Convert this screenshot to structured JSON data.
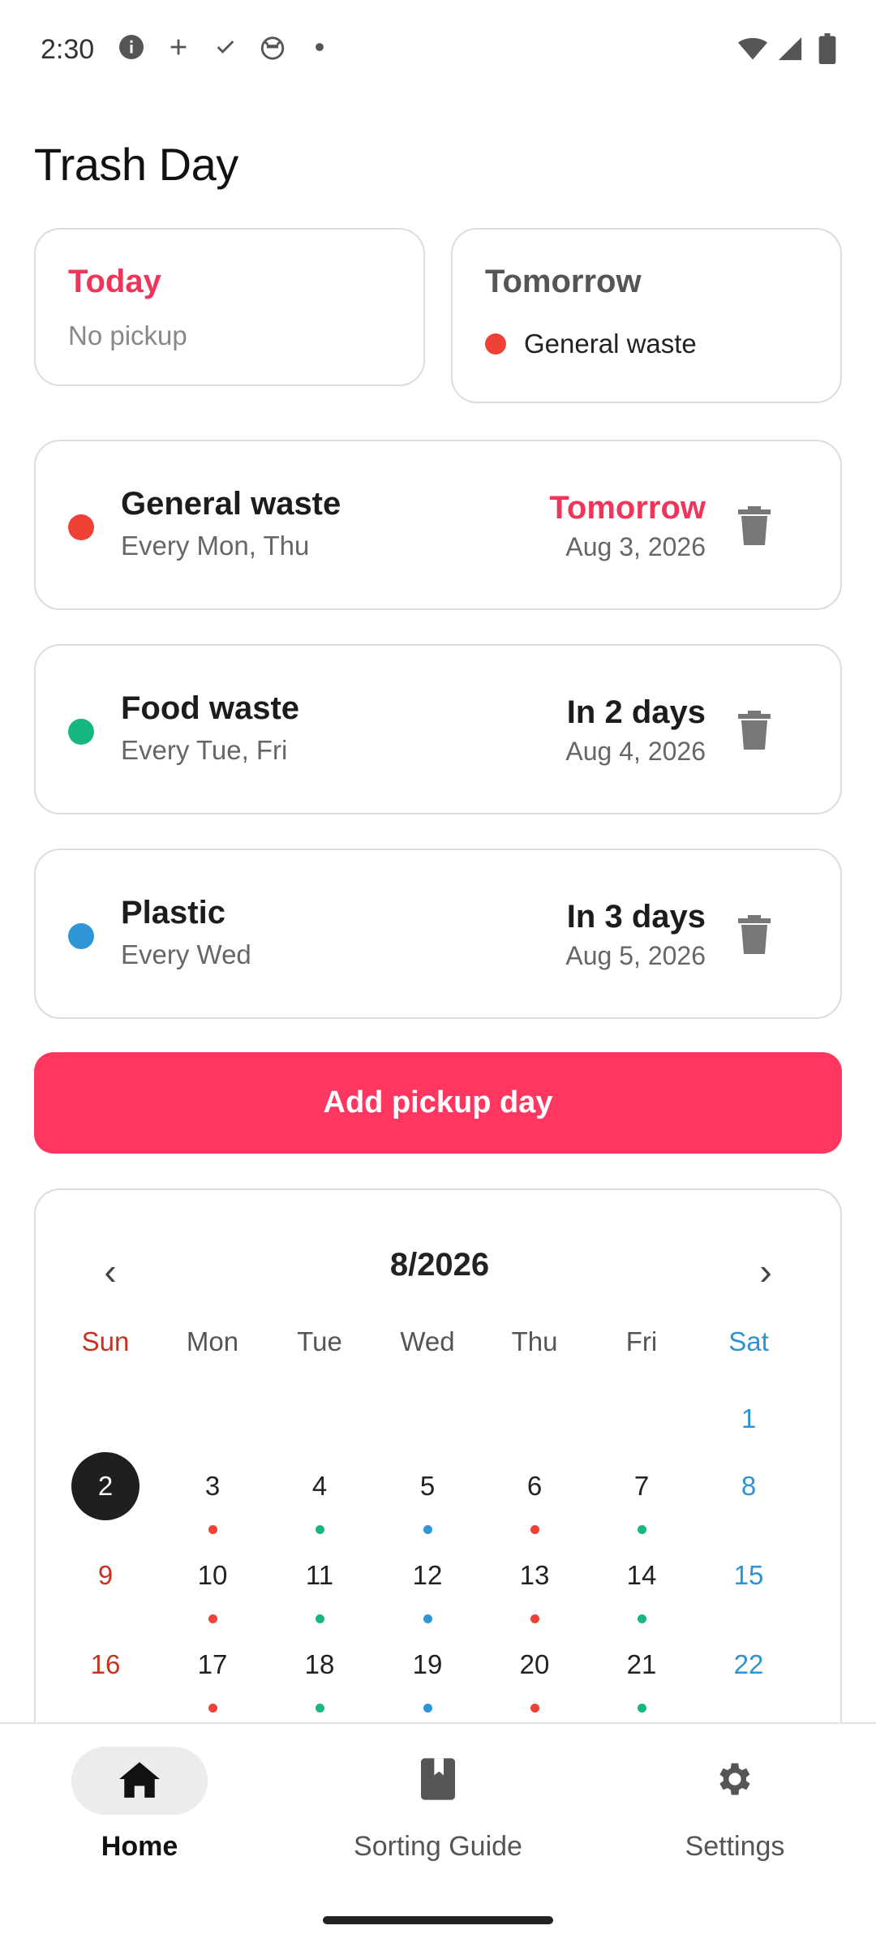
{
  "status_bar": {
    "time": "2:30",
    "left_icons": [
      "info-icon",
      "plus-icon",
      "check-icon",
      "cat-face-icon",
      "dot-icon"
    ],
    "right_icons": [
      "wifi-icon",
      "signal-icon",
      "battery-icon"
    ]
  },
  "header": {
    "title": "Trash Day"
  },
  "summary": {
    "today": {
      "label": "Today",
      "sub": "No pickup"
    },
    "tomorrow": {
      "label": "Tomorrow",
      "item": "General waste",
      "item_color": "#ef4136"
    }
  },
  "pickups": [
    {
      "name": "General waste",
      "schedule": "Every Mon, Thu",
      "when": "Tomorrow",
      "date": "Aug 3, 2026",
      "color": "#ef4136",
      "highlight": true
    },
    {
      "name": "Food waste",
      "schedule": "Every Tue, Fri",
      "when": "In 2 days",
      "date": "Aug 4, 2026",
      "color": "#17b87f",
      "highlight": false
    },
    {
      "name": "Plastic",
      "schedule": "Every Wed",
      "when": "In 3 days",
      "date": "Aug 5, 2026",
      "color": "#2f96d6",
      "highlight": false
    }
  ],
  "add_button": {
    "label": "Add pickup day"
  },
  "calendar": {
    "prev": "‹",
    "next": "›",
    "title": "8/2026",
    "weekdays": [
      "Sun",
      "Mon",
      "Tue",
      "Wed",
      "Thu",
      "Fri",
      "Sat"
    ],
    "selected_day": 2,
    "weeks": [
      [
        null,
        null,
        null,
        null,
        null,
        null,
        1
      ],
      [
        2,
        3,
        4,
        5,
        6,
        7,
        8
      ],
      [
        9,
        10,
        11,
        12,
        13,
        14,
        15
      ],
      [
        16,
        17,
        18,
        19,
        20,
        21,
        22
      ]
    ],
    "weekday_dot_colors": [
      null,
      "#ef4136",
      "#17b87f",
      "#2f96d6",
      "#ef4136",
      "#17b87f",
      null
    ]
  },
  "nav": {
    "items": [
      {
        "label": "Home",
        "icon": "home-icon",
        "active": true
      },
      {
        "label": "Sorting Guide",
        "icon": "book-icon",
        "active": false
      },
      {
        "label": "Settings",
        "icon": "gear-icon",
        "active": false
      }
    ]
  },
  "colors": {
    "accent": "#ff3660",
    "today_red": "#f0355a",
    "sunday": "#c8321f",
    "saturday": "#2e93d2"
  }
}
